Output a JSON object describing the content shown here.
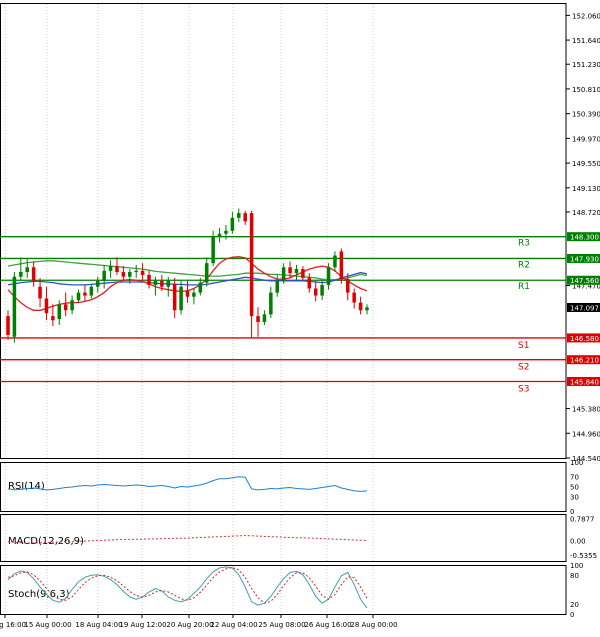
{
  "chart_data": {
    "type": "candlestick",
    "main": {
      "y_ticks": [
        "152.060",
        "151.640",
        "151.230",
        "150.810",
        "150.390",
        "149.970",
        "149.550",
        "149.130",
        "148.720",
        "148.300",
        "147.930",
        "147.560",
        "147.470",
        "147.097",
        "146.580",
        "146.210",
        "145.840",
        "145.380",
        "144.960",
        "144.540"
      ],
      "ylim": [
        144.54,
        152.27
      ],
      "current_price": {
        "value": 147.097,
        "label": "147.097"
      },
      "levels": [
        {
          "name": "R3",
          "value": 148.3,
          "label": "148.300",
          "color": "#008000"
        },
        {
          "name": "R2",
          "value": 147.93,
          "label": "147.930",
          "color": "#008000"
        },
        {
          "name": "R1",
          "value": 147.56,
          "label": "147.560",
          "color": "#008000"
        },
        {
          "name": "S1",
          "value": 146.58,
          "label": "146.580",
          "color": "#e00000"
        },
        {
          "name": "S2",
          "value": 146.21,
          "label": "146.210",
          "color": "#e00000"
        },
        {
          "name": "S3",
          "value": 145.84,
          "label": "145.840",
          "color": "#e00000"
        }
      ],
      "candles": [
        {
          "o": 146.95,
          "h": 147.05,
          "l": 146.55,
          "c": 146.63
        },
        {
          "o": 146.6,
          "h": 147.7,
          "l": 146.5,
          "c": 147.62
        },
        {
          "o": 147.62,
          "h": 147.95,
          "l": 147.55,
          "c": 147.7
        },
        {
          "o": 147.7,
          "h": 147.92,
          "l": 147.6,
          "c": 147.78
        },
        {
          "o": 147.78,
          "h": 147.88,
          "l": 147.45,
          "c": 147.55
        },
        {
          "o": 147.45,
          "h": 147.6,
          "l": 147.1,
          "c": 147.25
        },
        {
          "o": 147.25,
          "h": 147.45,
          "l": 146.88,
          "c": 147.0
        },
        {
          "o": 146.95,
          "h": 147.15,
          "l": 146.78,
          "c": 146.88
        },
        {
          "o": 146.9,
          "h": 147.22,
          "l": 146.8,
          "c": 147.15
        },
        {
          "o": 147.15,
          "h": 147.35,
          "l": 146.95,
          "c": 147.05
        },
        {
          "o": 147.05,
          "h": 147.3,
          "l": 146.98,
          "c": 147.22
        },
        {
          "o": 147.22,
          "h": 147.4,
          "l": 147.18,
          "c": 147.35
        },
        {
          "o": 147.35,
          "h": 147.48,
          "l": 147.2,
          "c": 147.3
        },
        {
          "o": 147.3,
          "h": 147.5,
          "l": 147.25,
          "c": 147.45
        },
        {
          "o": 147.45,
          "h": 147.62,
          "l": 147.35,
          "c": 147.55
        },
        {
          "o": 147.55,
          "h": 147.82,
          "l": 147.42,
          "c": 147.72
        },
        {
          "o": 147.72,
          "h": 147.9,
          "l": 147.6,
          "c": 147.8
        },
        {
          "o": 147.8,
          "h": 147.95,
          "l": 147.65,
          "c": 147.7
        },
        {
          "o": 147.7,
          "h": 147.8,
          "l": 147.55,
          "c": 147.62
        },
        {
          "o": 147.62,
          "h": 147.75,
          "l": 147.5,
          "c": 147.7
        },
        {
          "o": 147.7,
          "h": 147.82,
          "l": 147.6,
          "c": 147.72
        },
        {
          "o": 147.72,
          "h": 147.85,
          "l": 147.55,
          "c": 147.65
        },
        {
          "o": 147.65,
          "h": 147.72,
          "l": 147.42,
          "c": 147.48
        },
        {
          "o": 147.48,
          "h": 147.62,
          "l": 147.3,
          "c": 147.55
        },
        {
          "o": 147.55,
          "h": 147.65,
          "l": 147.38,
          "c": 147.45
        },
        {
          "o": 147.45,
          "h": 147.62,
          "l": 147.28,
          "c": 147.55
        },
        {
          "o": 147.5,
          "h": 147.6,
          "l": 146.92,
          "c": 147.05
        },
        {
          "o": 147.05,
          "h": 147.55,
          "l": 146.98,
          "c": 147.45
        },
        {
          "o": 147.38,
          "h": 147.55,
          "l": 147.18,
          "c": 147.28
        },
        {
          "o": 147.28,
          "h": 147.42,
          "l": 147.15,
          "c": 147.35
        },
        {
          "o": 147.35,
          "h": 147.6,
          "l": 147.3,
          "c": 147.52
        },
        {
          "o": 147.52,
          "h": 147.95,
          "l": 147.45,
          "c": 147.85
        },
        {
          "o": 147.85,
          "h": 148.4,
          "l": 147.8,
          "c": 148.3
        },
        {
          "o": 148.3,
          "h": 148.45,
          "l": 148.2,
          "c": 148.35
        },
        {
          "o": 148.35,
          "h": 148.5,
          "l": 148.25,
          "c": 148.4
        },
        {
          "o": 148.4,
          "h": 148.72,
          "l": 148.35,
          "c": 148.62
        },
        {
          "o": 148.62,
          "h": 148.78,
          "l": 148.55,
          "c": 148.7
        },
        {
          "o": 148.7,
          "h": 148.74,
          "l": 148.5,
          "c": 148.56
        },
        {
          "o": 148.7,
          "h": 148.74,
          "l": 146.58,
          "c": 146.95
        },
        {
          "o": 146.95,
          "h": 147.1,
          "l": 146.6,
          "c": 146.85
        },
        {
          "o": 146.85,
          "h": 147.05,
          "l": 146.8,
          "c": 146.98
        },
        {
          "o": 146.98,
          "h": 147.45,
          "l": 146.92,
          "c": 147.35
        },
        {
          "o": 147.35,
          "h": 147.65,
          "l": 147.28,
          "c": 147.55
        },
        {
          "o": 147.55,
          "h": 147.85,
          "l": 147.5,
          "c": 147.78
        },
        {
          "o": 147.78,
          "h": 147.88,
          "l": 147.6,
          "c": 147.68
        },
        {
          "o": 147.68,
          "h": 147.82,
          "l": 147.55,
          "c": 147.75
        },
        {
          "o": 147.75,
          "h": 147.8,
          "l": 147.55,
          "c": 147.6
        },
        {
          "o": 147.6,
          "h": 147.68,
          "l": 147.35,
          "c": 147.42
        },
        {
          "o": 147.42,
          "h": 147.55,
          "l": 147.2,
          "c": 147.3
        },
        {
          "o": 147.3,
          "h": 147.55,
          "l": 147.22,
          "c": 147.48
        },
        {
          "o": 147.48,
          "h": 147.85,
          "l": 147.4,
          "c": 147.78
        },
        {
          "o": 147.78,
          "h": 148.05,
          "l": 147.7,
          "c": 147.98
        },
        {
          "o": 148.05,
          "h": 148.1,
          "l": 147.5,
          "c": 147.58
        },
        {
          "o": 147.58,
          "h": 147.68,
          "l": 147.22,
          "c": 147.35
        },
        {
          "o": 147.35,
          "h": 147.42,
          "l": 147.08,
          "c": 147.18
        },
        {
          "o": 147.18,
          "h": 147.28,
          "l": 146.98,
          "c": 147.05
        },
        {
          "o": 147.05,
          "h": 147.15,
          "l": 146.98,
          "c": 147.1
        }
      ],
      "ma_blue": [
        147.48,
        147.5,
        147.52,
        147.53,
        147.54,
        147.54,
        147.53,
        147.52,
        147.5,
        147.49,
        147.48,
        147.48,
        147.48,
        147.49,
        147.5,
        147.51,
        147.52,
        147.53,
        147.53,
        147.53,
        147.53,
        147.53,
        147.52,
        147.51,
        147.5,
        147.5,
        147.49,
        147.49,
        147.48,
        147.48,
        147.48,
        147.49,
        147.51,
        147.53,
        147.55,
        147.57,
        147.59,
        147.61,
        147.6,
        147.58,
        147.56,
        147.55,
        147.55,
        147.55,
        147.55,
        147.55,
        147.55,
        147.54,
        147.53,
        147.52,
        147.53,
        147.56,
        147.6,
        147.63,
        147.66,
        147.69,
        147.67
      ],
      "ma_green": [
        147.8,
        147.82,
        147.84,
        147.86,
        147.87,
        147.88,
        147.89,
        147.89,
        147.88,
        147.87,
        147.86,
        147.85,
        147.84,
        147.83,
        147.82,
        147.81,
        147.8,
        147.79,
        147.78,
        147.77,
        147.76,
        147.75,
        147.73,
        147.71,
        147.7,
        147.69,
        147.68,
        147.67,
        147.66,
        147.65,
        147.64,
        147.63,
        147.63,
        147.63,
        147.64,
        147.65,
        147.66,
        147.68,
        147.68,
        147.68,
        147.67,
        147.66,
        147.66,
        147.65,
        147.64,
        147.63,
        147.62,
        147.61,
        147.6,
        147.58,
        147.57,
        147.57,
        147.58,
        147.6,
        147.63,
        147.66,
        147.64
      ],
      "ma_red": [
        147.4,
        147.28,
        147.18,
        147.1,
        147.05,
        147.05,
        147.08,
        147.12,
        147.15,
        147.17,
        147.18,
        147.18,
        147.2,
        147.23,
        147.28,
        147.35,
        147.45,
        147.52,
        147.56,
        147.57,
        147.56,
        147.54,
        147.5,
        147.45,
        147.42,
        147.4,
        147.38,
        147.37,
        147.38,
        147.42,
        147.48,
        147.58,
        147.72,
        147.85,
        147.92,
        147.95,
        147.96,
        147.94,
        147.85,
        147.75,
        147.68,
        147.62,
        147.58,
        147.58,
        147.6,
        147.65,
        147.7,
        147.75,
        147.78,
        147.8,
        147.78,
        147.72,
        147.62,
        147.55,
        147.48,
        147.42,
        147.38
      ]
    },
    "rsi": {
      "label": "RSI(14)",
      "y_ticks": [
        "100",
        "70",
        "50",
        "30",
        "0"
      ],
      "values": [
        45,
        43,
        44,
        46,
        47,
        45,
        43,
        44,
        46,
        48,
        49,
        51,
        52,
        51,
        53,
        54,
        53,
        52,
        51,
        52,
        53,
        52,
        50,
        51,
        52,
        50,
        47,
        50,
        49,
        51,
        53,
        57,
        62,
        66,
        66,
        68,
        70,
        69,
        45,
        43,
        44,
        46,
        45,
        47,
        48,
        46,
        45,
        44,
        46,
        48,
        50,
        52,
        47,
        44,
        41,
        40,
        41
      ]
    },
    "macd": {
      "label": "MACD(12,26,9)",
      "y_ticks": [
        "0.7877",
        "0.00",
        "-0.5355"
      ],
      "ylim": [
        -0.75,
        0.95
      ],
      "values": [
        -0.05,
        -0.07,
        -0.09,
        -0.1,
        -0.1,
        -0.09,
        -0.08,
        -0.07,
        -0.06,
        -0.05,
        -0.04,
        -0.04,
        -0.03,
        -0.02,
        -0.01,
        0.0,
        0.01,
        0.02,
        0.03,
        0.03,
        0.04,
        0.04,
        0.05,
        0.05,
        0.06,
        0.06,
        0.07,
        0.07,
        0.08,
        0.09,
        0.1,
        0.11,
        0.12,
        0.13,
        0.14,
        0.15,
        0.16,
        0.17,
        0.16,
        0.15,
        0.14,
        0.13,
        0.12,
        0.11,
        0.1,
        0.09,
        0.09,
        0.08,
        0.07,
        0.06,
        0.05,
        0.04,
        0.03,
        0.02,
        0.01,
        0.0,
        -0.01
      ]
    },
    "stoch": {
      "label": "Stoch(9,6,3)",
      "y_ticks": [
        "100",
        "80",
        "20",
        "0"
      ],
      "k": [
        70,
        82,
        88,
        85,
        72,
        55,
        40,
        28,
        24,
        32,
        50,
        66,
        75,
        79,
        80,
        77,
        70,
        60,
        46,
        35,
        30,
        35,
        45,
        52,
        47,
        35,
        28,
        25,
        30,
        42,
        55,
        72,
        86,
        94,
        96,
        94,
        80,
        55,
        25,
        18,
        22,
        36,
        55,
        72,
        85,
        87,
        80,
        60,
        36,
        22,
        30,
        55,
        78,
        85,
        60,
        30,
        12
      ],
      "d": [
        75,
        78,
        84,
        86,
        80,
        68,
        52,
        38,
        30,
        28,
        35,
        50,
        64,
        73,
        78,
        79,
        75,
        68,
        57,
        46,
        38,
        34,
        38,
        45,
        48,
        45,
        38,
        31,
        28,
        33,
        44,
        59,
        74,
        86,
        92,
        95,
        90,
        75,
        52,
        33,
        22,
        26,
        40,
        58,
        74,
        84,
        84,
        74,
        57,
        38,
        30,
        40,
        60,
        76,
        74,
        55,
        32
      ]
    },
    "x_ticks": [
      "14 Aug 16:00",
      "15 Aug 00:00",
      "18 Aug 04:00",
      "19 Aug 12:00",
      "20 Aug 20:00",
      "22 Aug 04:00",
      "25 Aug 08:00",
      "26 Aug 16:00",
      "28 Aug 00:00"
    ]
  },
  "colors": {
    "bull": "#008000",
    "bear": "#e00000",
    "ma_blue": "#3050d0",
    "ma_green": "#40a040",
    "ma_red": "#e02020",
    "rsi": "#2080d0",
    "macd": "#d03030",
    "stoch_k": "#40a0b0",
    "stoch_d": "#e02020",
    "grid": "#c8c8c8"
  }
}
